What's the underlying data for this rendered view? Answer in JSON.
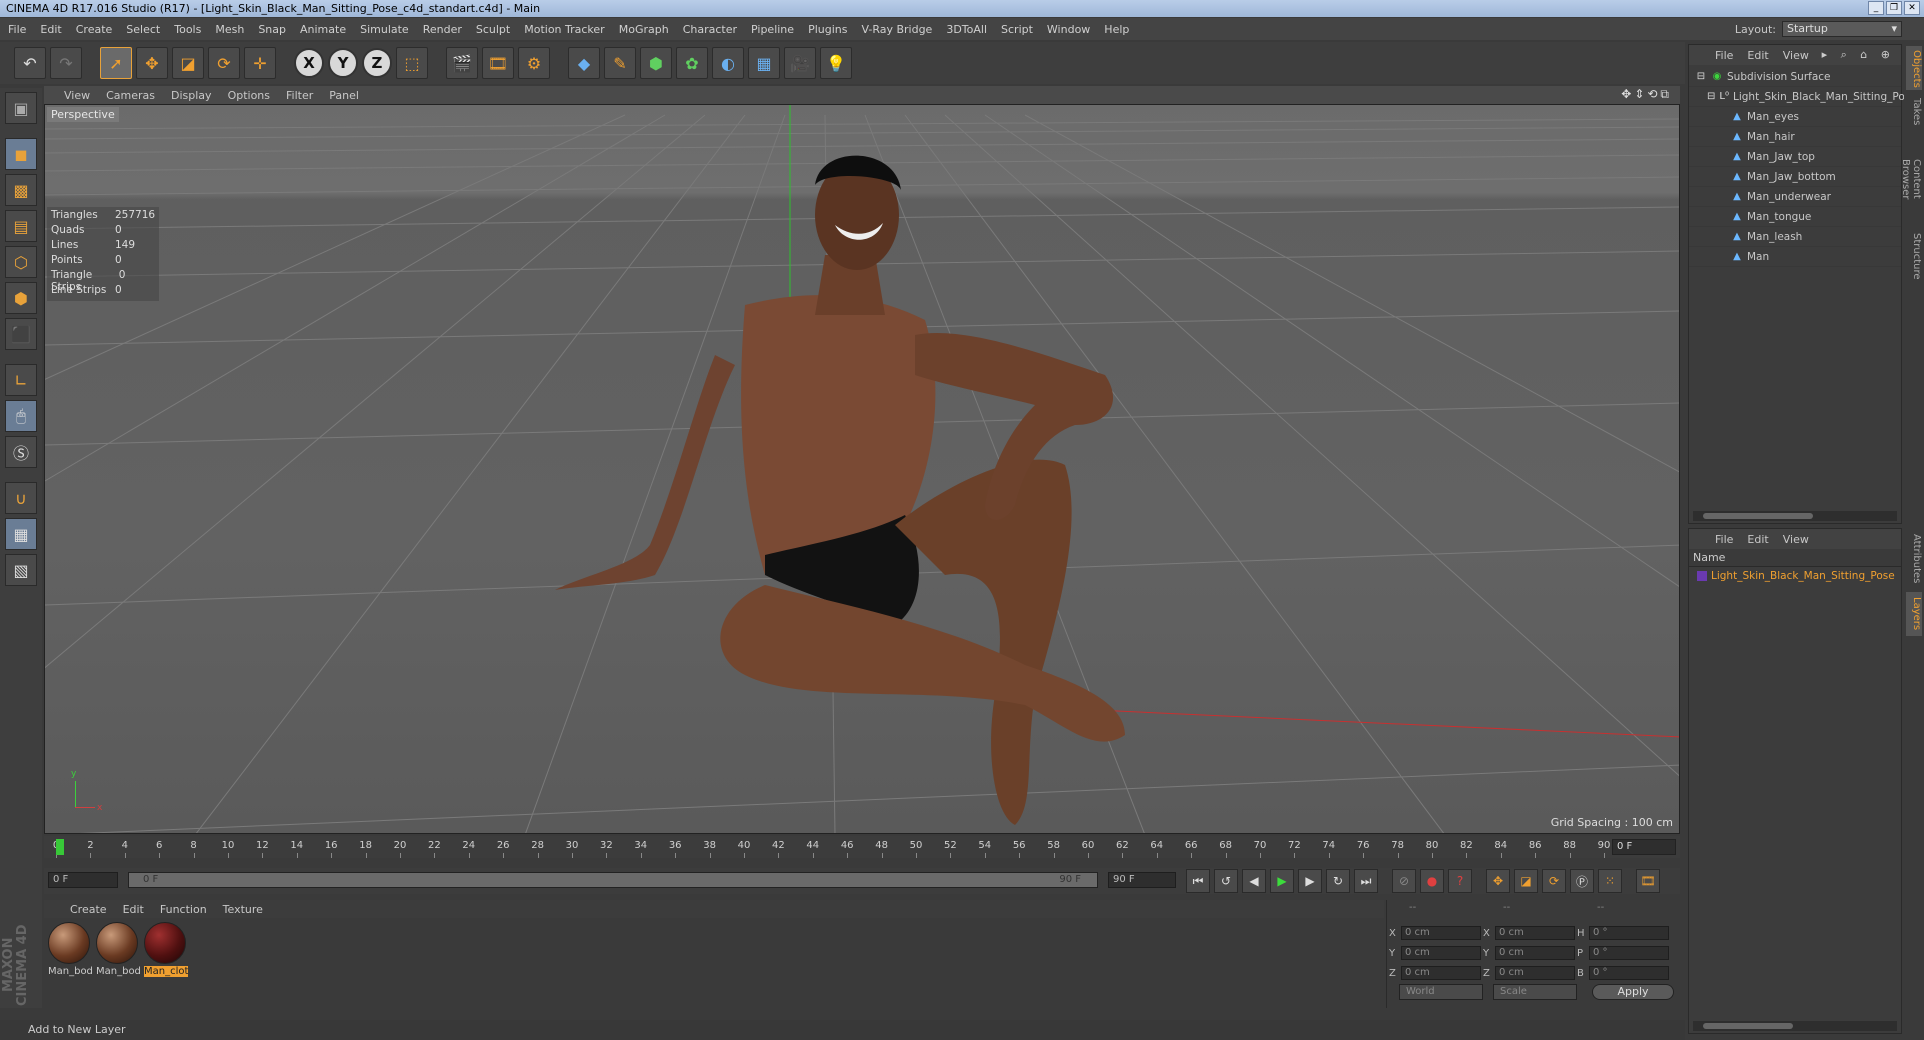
{
  "window": {
    "title": "CINEMA 4D R17.016 Studio (R17) - [Light_Skin_Black_Man_Sitting_Pose_c4d_standart.c4d] - Main"
  },
  "menu": [
    "File",
    "Edit",
    "Create",
    "Select",
    "Tools",
    "Mesh",
    "Snap",
    "Animate",
    "Simulate",
    "Render",
    "Sculpt",
    "Motion Tracker",
    "MoGraph",
    "Character",
    "Pipeline",
    "Plugins",
    "V-Ray Bridge",
    "3DToAll",
    "Script",
    "Window",
    "Help"
  ],
  "layout": {
    "label": "Layout:",
    "value": "Startup"
  },
  "viewport": {
    "menu": [
      "View",
      "Cameras",
      "Display",
      "Options",
      "Filter",
      "Panel"
    ],
    "camera_label": "Perspective",
    "grid_spacing": "Grid Spacing : 100 cm",
    "stats": [
      {
        "label": "Triangles",
        "value": "257716"
      },
      {
        "label": "Quads",
        "value": "0"
      },
      {
        "label": "Lines",
        "value": "149"
      },
      {
        "label": "Points",
        "value": "0"
      },
      {
        "label": "Triangle Strips",
        "value": "0"
      },
      {
        "label": "Line Strips",
        "value": "0"
      }
    ],
    "axis_labels": {
      "x": "x",
      "y": "y"
    }
  },
  "timeline": {
    "ticks": [
      "0",
      "2",
      "4",
      "6",
      "8",
      "10",
      "12",
      "14",
      "16",
      "18",
      "20",
      "22",
      "24",
      "26",
      "28",
      "30",
      "32",
      "34",
      "36",
      "38",
      "40",
      "42",
      "44",
      "46",
      "48",
      "50",
      "52",
      "54",
      "56",
      "58",
      "60",
      "62",
      "64",
      "66",
      "68",
      "70",
      "72",
      "74",
      "76",
      "78",
      "80",
      "82",
      "84",
      "86",
      "88",
      "90"
    ],
    "current_frame": "0 F"
  },
  "transport": {
    "start_field": "0 F",
    "range_start": "0 F",
    "range_end": "90 F",
    "end_field": "90 F"
  },
  "materials": {
    "menu": [
      "Create",
      "Edit",
      "Function",
      "Texture"
    ],
    "items": [
      {
        "name": "Man_bod",
        "selected": false
      },
      {
        "name": "Man_bod",
        "selected": false
      },
      {
        "name": "Man_clot",
        "selected": true
      }
    ]
  },
  "coordinates": {
    "header": [
      "--",
      "--",
      "--"
    ],
    "rows": [
      {
        "a": "X",
        "av": "0 cm",
        "b": "X",
        "bv": "0 cm",
        "c": "H",
        "cv": "0 °"
      },
      {
        "a": "Y",
        "av": "0 cm",
        "b": "Y",
        "bv": "0 cm",
        "c": "P",
        "cv": "0 °"
      },
      {
        "a": "Z",
        "av": "0 cm",
        "b": "Z",
        "bv": "0 cm",
        "c": "B",
        "cv": "0 °"
      }
    ],
    "mode": "World",
    "scale": "Scale",
    "apply": "Apply"
  },
  "status": "Add to New Layer",
  "logo": {
    "line1": "MAXON",
    "line2": "CINEMA 4D"
  },
  "objects": {
    "menu": [
      "File",
      "Edit",
      "View"
    ],
    "tree": [
      {
        "name": "Subdivision Surface",
        "depth": 0,
        "icon": "subdivision-icon"
      },
      {
        "name": "Light_Skin_Black_Man_Sitting_Pose",
        "depth": 1,
        "icon": "null-icon"
      },
      {
        "name": "Man_eyes",
        "depth": 2,
        "icon": "polygon-icon"
      },
      {
        "name": "Man_hair",
        "depth": 2,
        "icon": "polygon-icon"
      },
      {
        "name": "Man_Jaw_top",
        "depth": 2,
        "icon": "polygon-icon"
      },
      {
        "name": "Man_Jaw_bottom",
        "depth": 2,
        "icon": "polygon-icon"
      },
      {
        "name": "Man_underwear",
        "depth": 2,
        "icon": "polygon-icon"
      },
      {
        "name": "Man_tongue",
        "depth": 2,
        "icon": "polygon-icon"
      },
      {
        "name": "Man_leash",
        "depth": 2,
        "icon": "polygon-icon"
      },
      {
        "name": "Man",
        "depth": 2,
        "icon": "polygon-icon"
      }
    ]
  },
  "layers": {
    "menu": [
      "File",
      "Edit",
      "View"
    ],
    "column": "Name",
    "items": [
      {
        "name": "Light_Skin_Black_Man_Sitting_Pose",
        "color": "#6a3ab0"
      }
    ]
  },
  "side_tabs": {
    "top": [
      "Objects",
      "Takes",
      "Content Browser",
      "Structure"
    ],
    "bottom": [
      "Attributes",
      "Layers"
    ]
  }
}
